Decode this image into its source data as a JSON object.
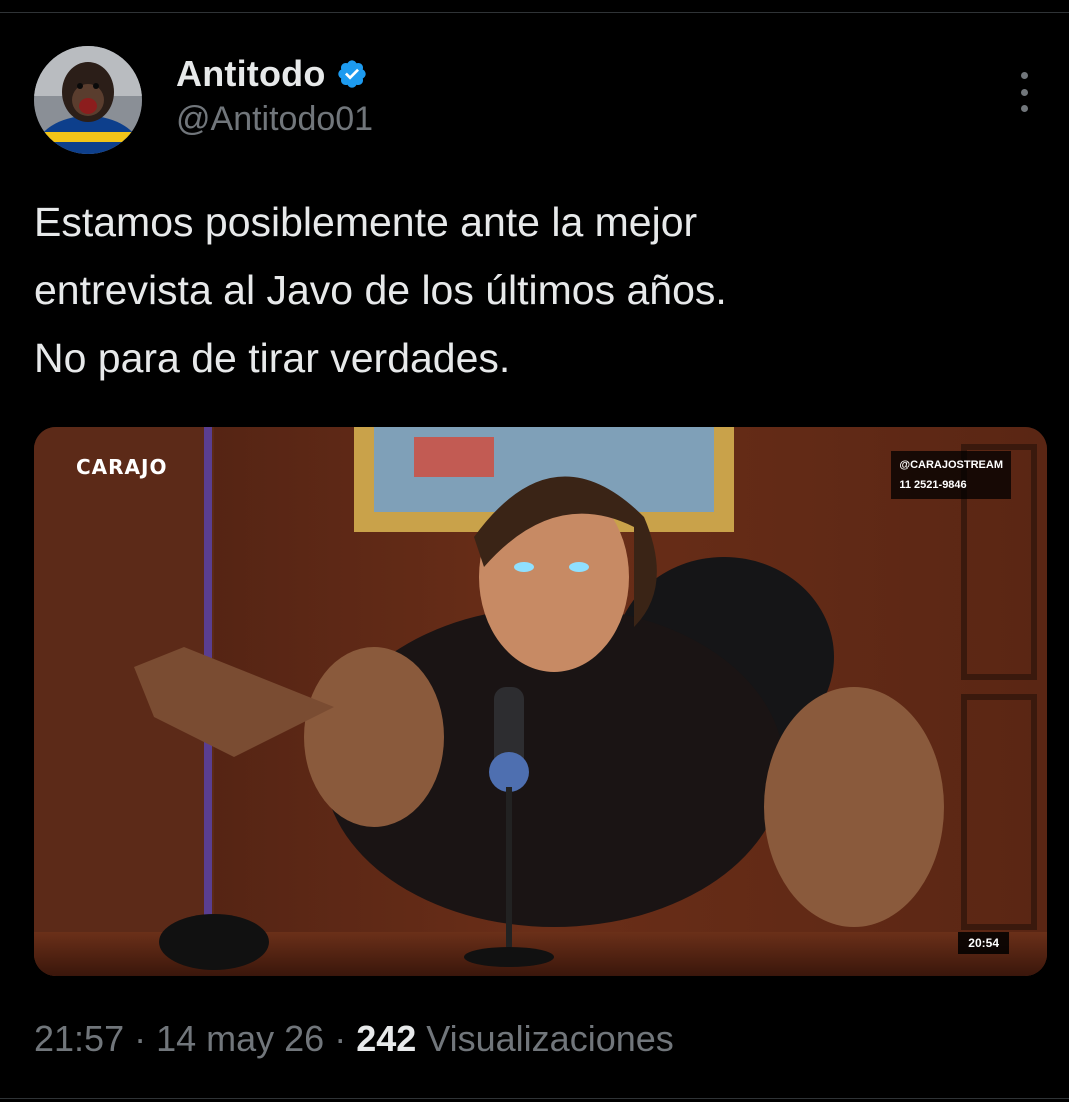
{
  "author": {
    "display_name": "Antitodo",
    "handle": "@Antitodo01",
    "verified": true,
    "verified_icon": "verified-badge-icon",
    "avatar_description": "avatar"
  },
  "more_menu": {
    "icon": "more-vertical-icon"
  },
  "tweet": {
    "lines": [
      "Estamos posiblemente ante la mejor",
      "entrevista al Javo de los últimos años.",
      "No para de tirar verdades."
    ]
  },
  "media": {
    "logo_text": "CARAJO",
    "social_lines": [
      "@CARAJOSTREAM",
      "11 2521-9846"
    ],
    "timestamp": "20:54"
  },
  "meta": {
    "time": "21:57",
    "separator": " · ",
    "date": "14 may 26",
    "views": "242",
    "views_label": " Visualizaciones"
  },
  "colors": {
    "background": "#000000",
    "text_primary": "#e7e9ea",
    "text_secondary": "#71767b",
    "verified_blue": "#1d9bf0",
    "divider": "#2f3336"
  }
}
